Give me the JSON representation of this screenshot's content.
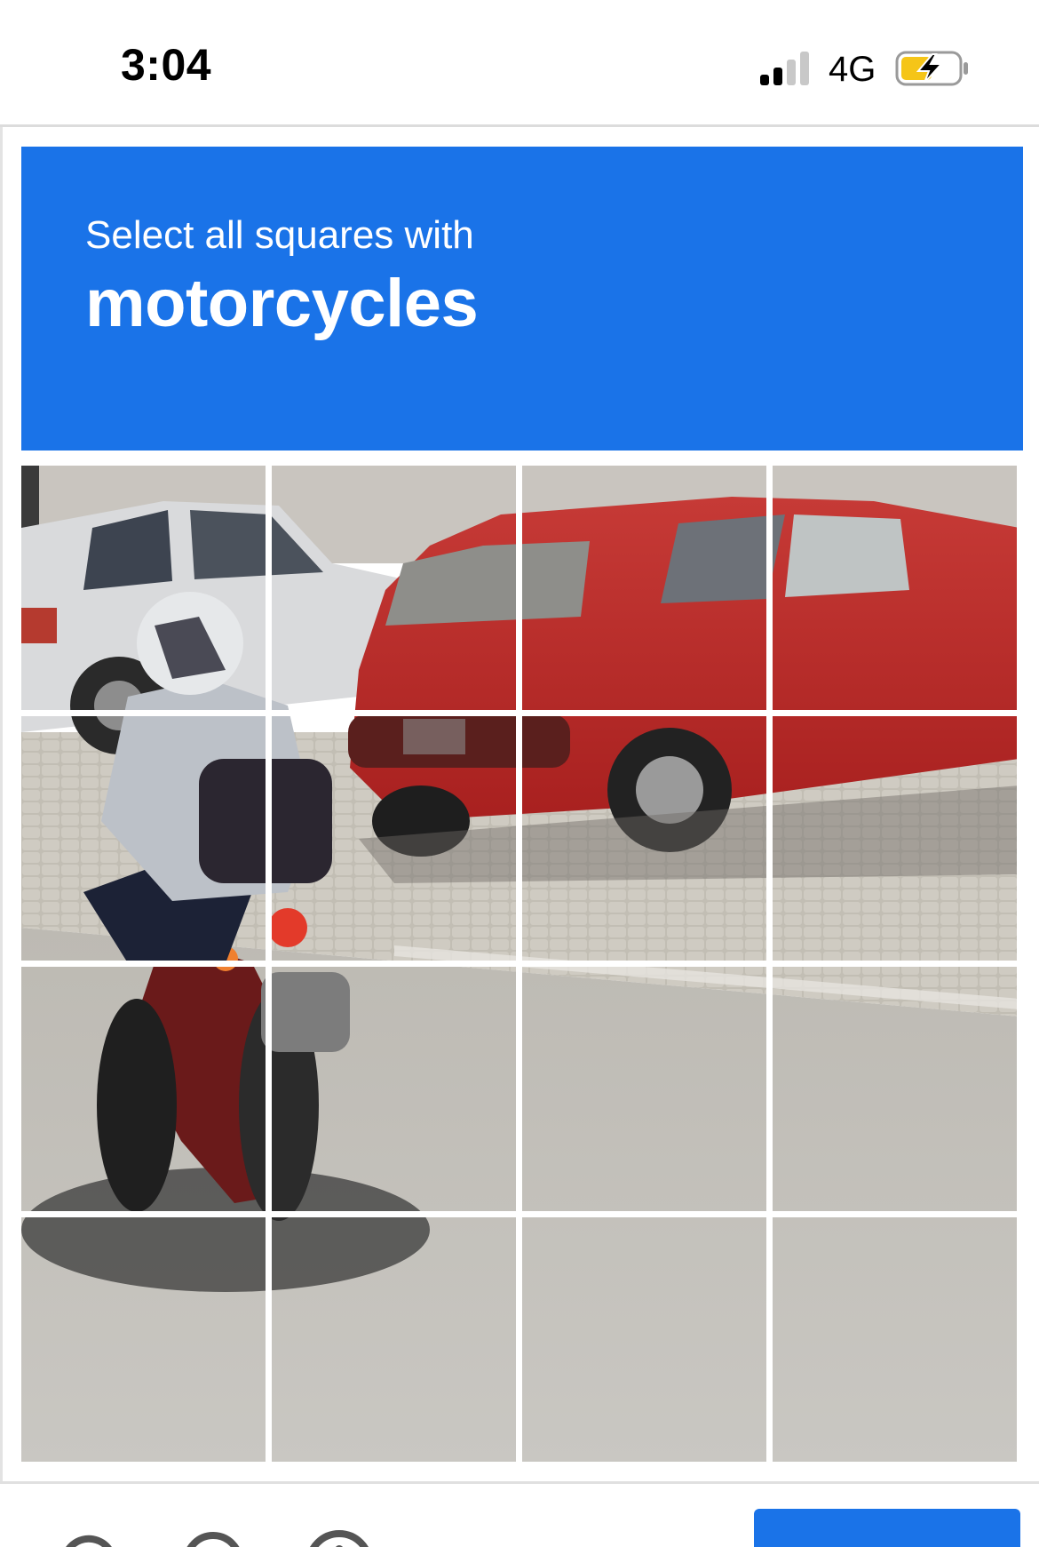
{
  "status_bar": {
    "time": "3:04",
    "network": "4G",
    "signal_bars": 4,
    "signal_active_bars": 2,
    "battery_charging": true
  },
  "challenge": {
    "prompt": "Select all squares with",
    "target": "motorcycles",
    "accent_color": "#1a73e8",
    "grid_rows": 4,
    "grid_cols": 4
  },
  "footer": {
    "icons": [
      "reload-icon",
      "headphones-icon",
      "info-icon"
    ],
    "verify_label": ""
  }
}
